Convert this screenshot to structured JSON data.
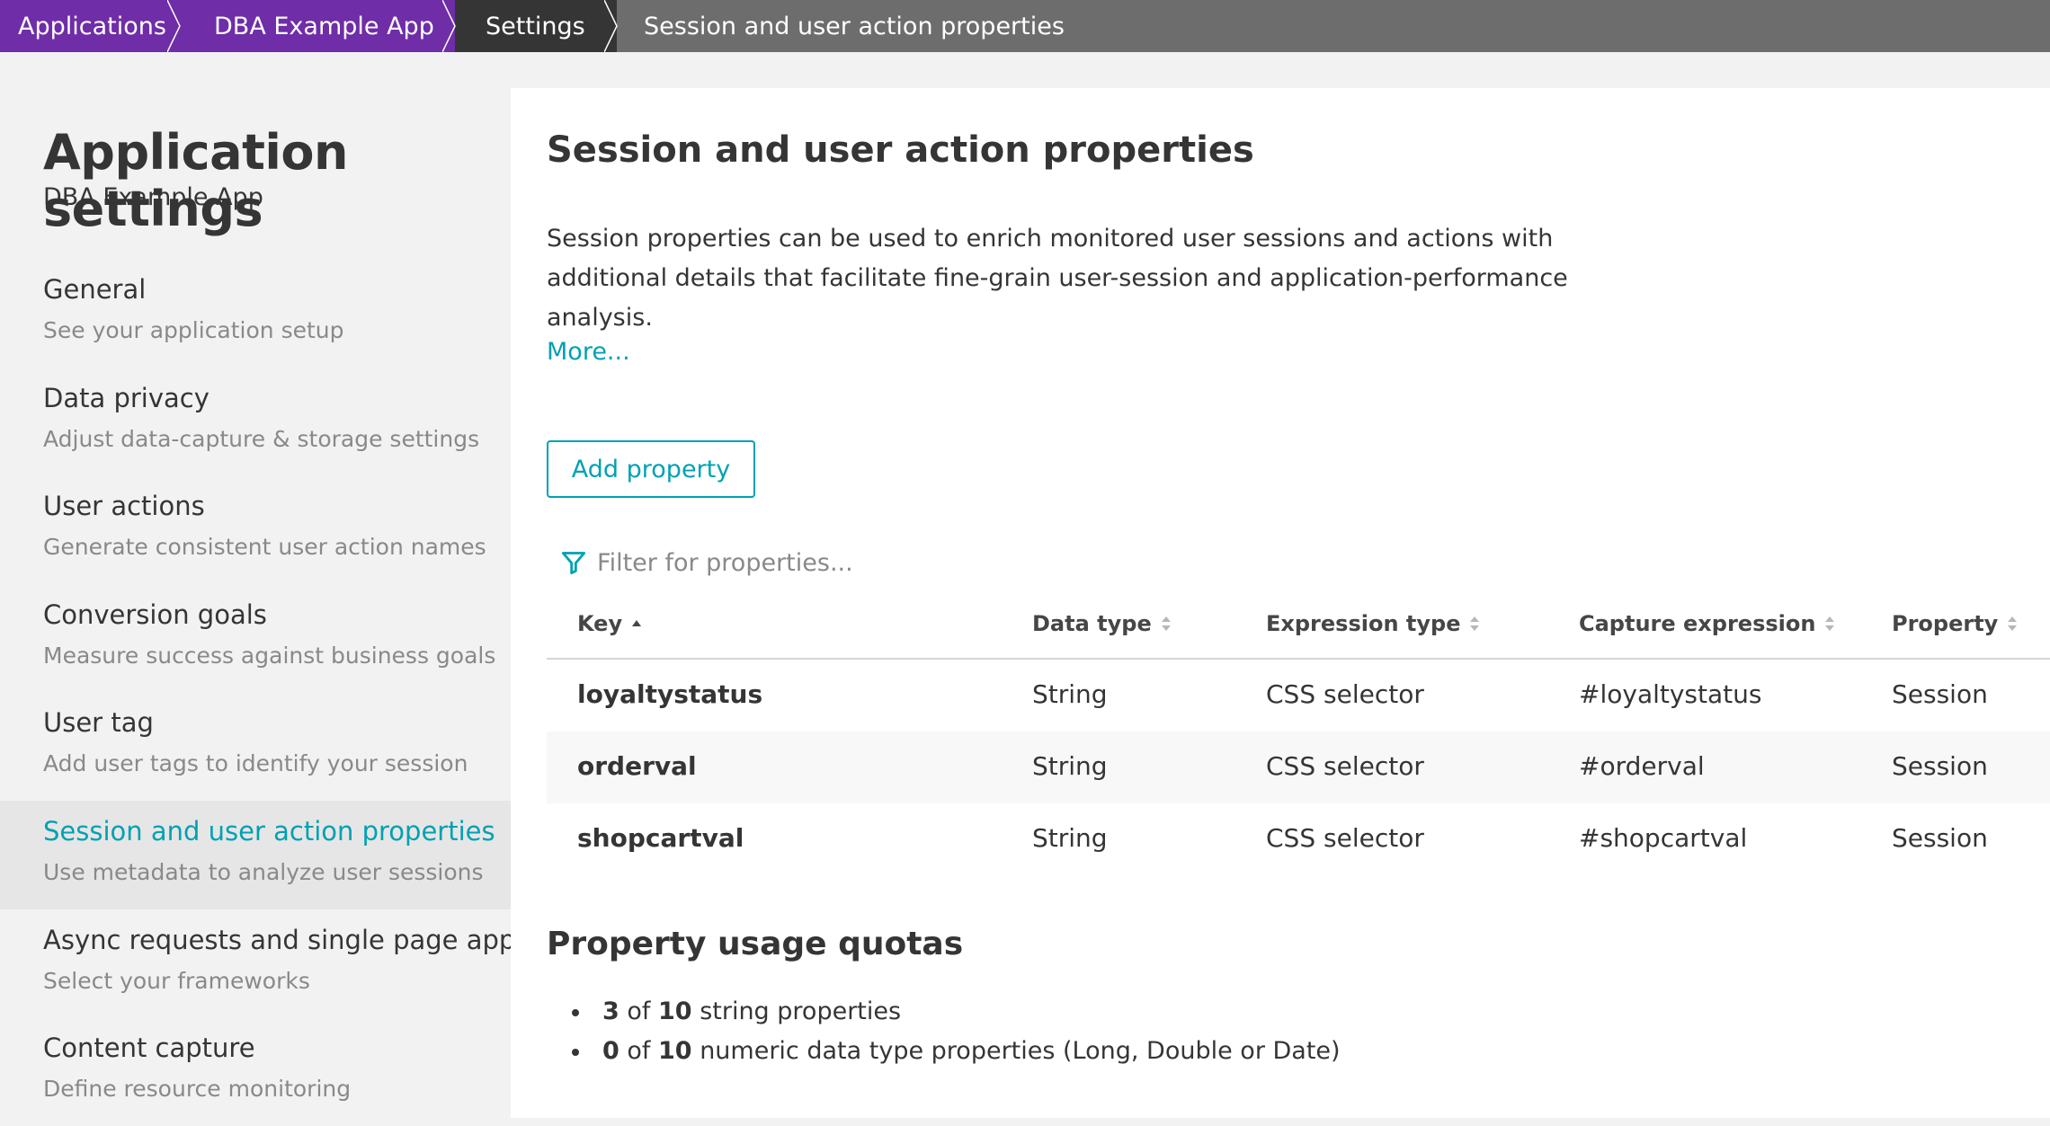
{
  "breadcrumb": {
    "items": [
      "Applications",
      "DBA Example App",
      "Settings",
      "Session and user action properties"
    ]
  },
  "sidebar": {
    "title": "Application settings",
    "subtitle": "DBA Example App",
    "items": [
      {
        "label": "General",
        "desc": "See your application setup"
      },
      {
        "label": "Data privacy",
        "desc": "Adjust data-capture & storage settings"
      },
      {
        "label": "User actions",
        "desc": "Generate consistent user action names"
      },
      {
        "label": "Conversion goals",
        "desc": "Measure success against business goals"
      },
      {
        "label": "User tag",
        "desc": "Add user tags to identify your session"
      },
      {
        "label": "Session and user action properties",
        "desc": "Use metadata to analyze user sessions"
      },
      {
        "label": "Async requests and single page apps",
        "desc": "Select your frameworks"
      },
      {
        "label": "Content capture",
        "desc": "Define resource monitoring"
      }
    ]
  },
  "main": {
    "title": "Session and user action properties",
    "intro": "Session properties can be used to enrich monitored user sessions and actions with additional details that facilitate fine-grain user-session and application-performance analysis.",
    "more_link": "More...",
    "add_button": "Add property",
    "filter_placeholder": "Filter for properties...",
    "table": {
      "headers": [
        "Key",
        "Data type",
        "Expression type",
        "Capture expression",
        "Property"
      ],
      "rows": [
        {
          "key": "loyaltystatus",
          "data_type": "String",
          "expression_type": "CSS selector",
          "capture_expression": "#loyaltystatus",
          "property": "Session"
        },
        {
          "key": "orderval",
          "data_type": "String",
          "expression_type": "CSS selector",
          "capture_expression": "#orderval",
          "property": "Session"
        },
        {
          "key": "shopcartval",
          "data_type": "String",
          "expression_type": "CSS selector",
          "capture_expression": "#shopcartval",
          "property": "Session"
        }
      ]
    },
    "quotas": {
      "title": "Property usage quotas",
      "items": [
        {
          "used": "3",
          "of": "of",
          "total": "10",
          "text": "string properties"
        },
        {
          "used": "0",
          "of": "of",
          "total": "10",
          "text": "numeric data type properties (Long, Double or Date)"
        }
      ]
    }
  },
  "colors": {
    "brand_purple": "#6f2da8",
    "crumb_dark": "#353535",
    "crumb_gray": "#6d6d6d",
    "accent_teal": "#00a1b2"
  }
}
